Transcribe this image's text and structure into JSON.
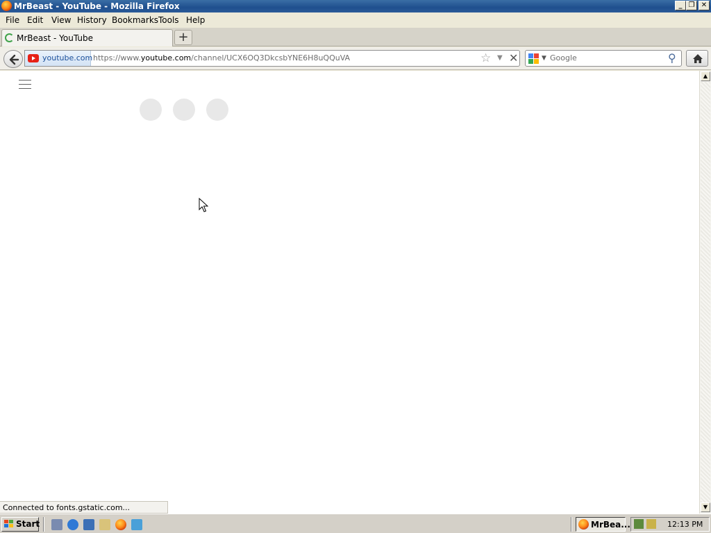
{
  "window": {
    "title": "MrBeast - YouTube - Mozilla Firefox",
    "controls": [
      "_",
      "❐",
      "✕"
    ]
  },
  "menu": {
    "items": [
      {
        "label": "File"
      },
      {
        "label": "Edit"
      },
      {
        "label": "View"
      },
      {
        "label": "History"
      },
      {
        "label": "Bookmarks"
      },
      {
        "label": "Tools"
      },
      {
        "label": "Help"
      }
    ]
  },
  "tabs": {
    "active": {
      "label": "MrBeast - YouTube",
      "icon": "loading-spinner-icon"
    },
    "new_tab_label": "+"
  },
  "navbar": {
    "identity_domain": "youtube.com",
    "url_prefix": "https://www.",
    "url_host": "youtube.com",
    "url_path": "/channel/UCX6OQ3DkcsbYNE6H8uQQuVA",
    "search_placeholder": "Google",
    "search_engine_icon": "google-icon"
  },
  "content": {
    "loading_dots": 3
  },
  "status": {
    "text": "Connected to fonts.gstatic.com..."
  },
  "taskbar": {
    "start_label": "Start",
    "quick_launch": [
      "show-desktop-icon",
      "internet-explorer-icon",
      "outlook-icon",
      "search-icon",
      "firefox-icon",
      "messenger-icon"
    ],
    "task_button_label": "MrBea...",
    "clock": "12:13 PM"
  },
  "colors": {
    "titlebar": "#1f4f8e",
    "youtube_red": "#e62117",
    "loading_dot": "#e8e8e8"
  }
}
